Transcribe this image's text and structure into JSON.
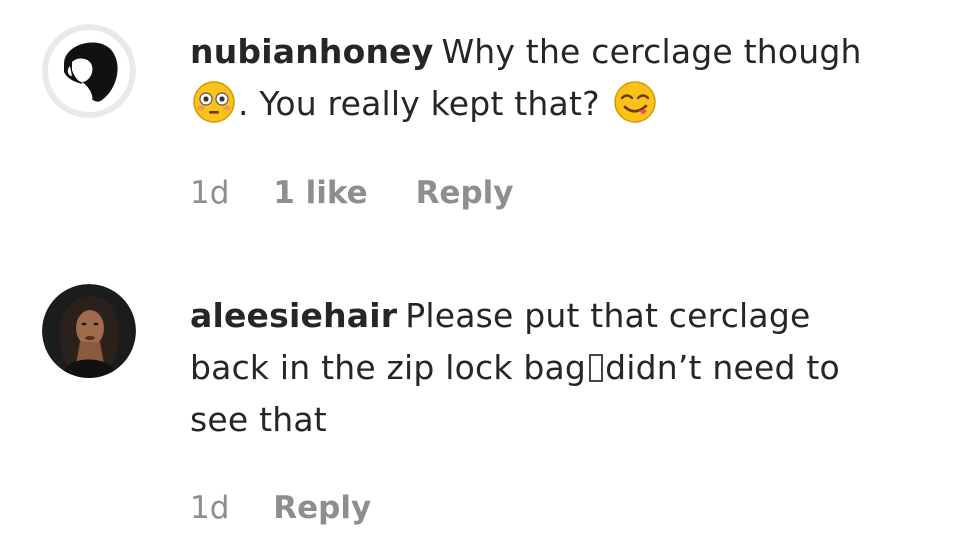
{
  "comments": [
    {
      "username": "nubianhoney",
      "text_part1": "Why the cerclage though",
      "text_part2": ". You really kept that?",
      "emoji1": "flushed-face-icon",
      "emoji2": "smirking-face-icon",
      "time": "1d",
      "likes": "1 like",
      "reply_label": "Reply"
    },
    {
      "username": "aleesiehair",
      "text_part1": "Please put that cerclage back in the zip lock bag",
      "text_part2": "didn’t need to see that",
      "time": "1d",
      "reply_label": "Reply"
    }
  ],
  "colors": {
    "text": "#262626",
    "meta": "#8e8e8e",
    "background": "#ffffff"
  }
}
